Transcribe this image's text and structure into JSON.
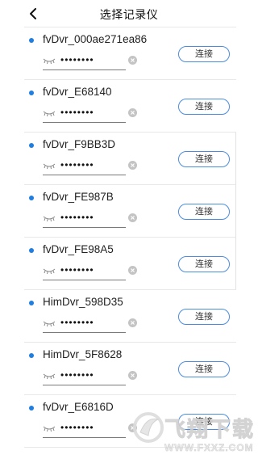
{
  "header": {
    "title": "选择记录仪",
    "back_icon": "chevron-left-icon"
  },
  "colors": {
    "accent": "#1f7ee0",
    "button_border": "#4a8de0"
  },
  "devices": [
    {
      "name": "fvDvr_000ae271ea86",
      "password_mask": "••••••••",
      "connect_label": "连接"
    },
    {
      "name": "fvDvr_E68140",
      "password_mask": "••••••••",
      "connect_label": "连接"
    },
    {
      "name": "fvDvr_F9BB3D",
      "password_mask": "••••••••",
      "connect_label": "连接"
    },
    {
      "name": "fvDvr_FE987B",
      "password_mask": "••••••••",
      "connect_label": "连接"
    },
    {
      "name": "fvDvr_FE98A5",
      "password_mask": "••••••••",
      "connect_label": "连接"
    },
    {
      "name": "HimDvr_598D35",
      "password_mask": "••••••••",
      "connect_label": "连接"
    },
    {
      "name": "HimDvr_5F8628",
      "password_mask": "••••••••",
      "connect_label": "连接"
    },
    {
      "name": "fvDvr_E6816D",
      "password_mask": "••••••••",
      "connect_label": "连接"
    }
  ],
  "watermark": {
    "title": "飞翔下载",
    "domain": "WWW.FXXZ.COM"
  }
}
